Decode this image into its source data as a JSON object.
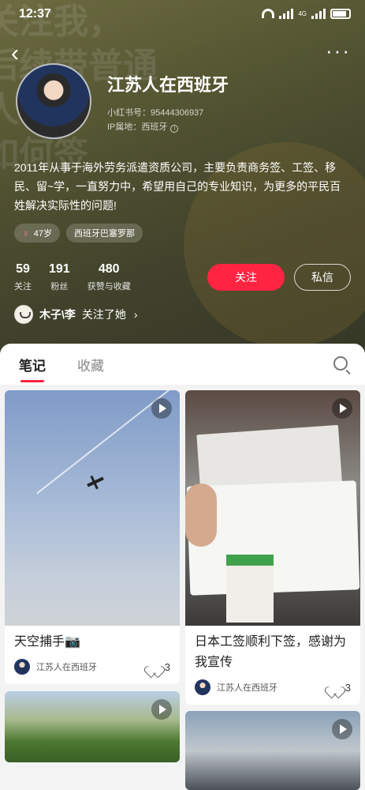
{
  "status_bar": {
    "time": "12:37",
    "network": "4G"
  },
  "profile": {
    "name": "江苏人在西班牙",
    "id_text": "小红书号：95444306937",
    "ip_text": "IP属地：西班牙",
    "bio": "2011年从事于海外劳务派遣资质公司，主要负责商务签、工签、移民、留~学，一直努力中，希望用自己的专业知识，为更多的平民百姓解决实际性的问题!",
    "tags": {
      "age": "47岁",
      "location": "西班牙巴塞罗那"
    },
    "stats": [
      {
        "num": "59",
        "label": "关注"
      },
      {
        "num": "191",
        "label": "粉丝"
      },
      {
        "num": "480",
        "label": "获赞与收藏"
      }
    ],
    "follow_label": "关注",
    "message_label": "私信",
    "mutual": {
      "user": "木子\\李",
      "text": "关注了她"
    }
  },
  "tabs": {
    "notes": "笔记",
    "collect": "收藏"
  },
  "posts": [
    {
      "title": "天空捕手📷",
      "author": "江苏人在西班牙",
      "likes": "3"
    },
    {
      "title": "日本工签顺利下签，感谢为我宣传",
      "author": "江苏人在西班牙",
      "likes": "3"
    }
  ]
}
